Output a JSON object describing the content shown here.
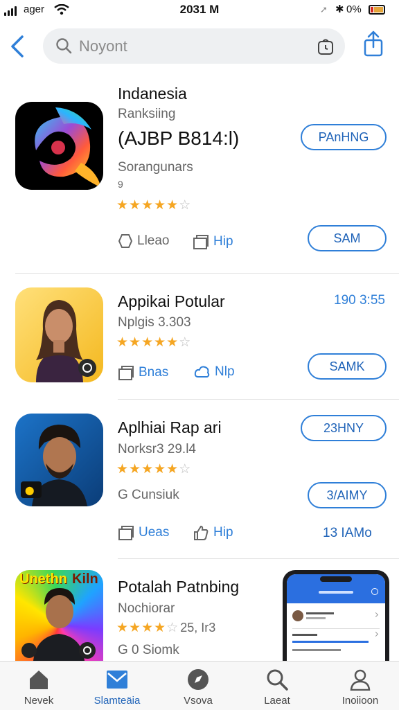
{
  "status_bar": {
    "carrier": "ager",
    "time": "2031 M",
    "battery_pct": "0%"
  },
  "search": {
    "placeholder": "Noyont"
  },
  "apps": [
    {
      "title": "Indanesia",
      "subtitle": "Ranksiing",
      "highlight": "(AJBP B814:l)",
      "developer": "Sorangunars",
      "note": "9",
      "rating_stars": 4,
      "primary_button": "PAnHNG",
      "secondary_button": "SAM",
      "action1": "Lleao",
      "action2": "Hip"
    },
    {
      "title": "Appikai Potular",
      "subtitle": "Nplgis 3.303",
      "rating_stars": 4,
      "meta_right": "190 3:55",
      "primary_button": "SAMK",
      "action1": "Bnas",
      "action2": "Nlp"
    },
    {
      "title": "Aplhiai Rap ari",
      "subtitle": "Norksr3 29.l4",
      "rating_stars": 4,
      "developer": "G Cunsiuk",
      "primary_button": "23HNY",
      "secondary_button": "3/AIMY",
      "action1": "Ueas",
      "action2": "Hip",
      "meta_right": "13 IAMo"
    },
    {
      "title": "Potalah Patnbing",
      "subtitle": "Nochiorar",
      "rating_stars": 4,
      "rating_extra": "25, Ir3",
      "developer": "G 0 Siomk",
      "poster_line1": "Unethn",
      "poster_line2": "Kiln"
    }
  ],
  "tabs": [
    {
      "label": "Nevek",
      "icon": "home-icon"
    },
    {
      "label": "Slamteäia",
      "icon": "mail-icon"
    },
    {
      "label": "Vsova",
      "icon": "compass-icon"
    },
    {
      "label": "Laeat",
      "icon": "search-icon"
    },
    {
      "label": "Inoiioon",
      "icon": "person-icon"
    }
  ],
  "colors": {
    "accent": "#2f7fd8",
    "star": "#f5a623",
    "phone_header": "#2b6fe0"
  }
}
